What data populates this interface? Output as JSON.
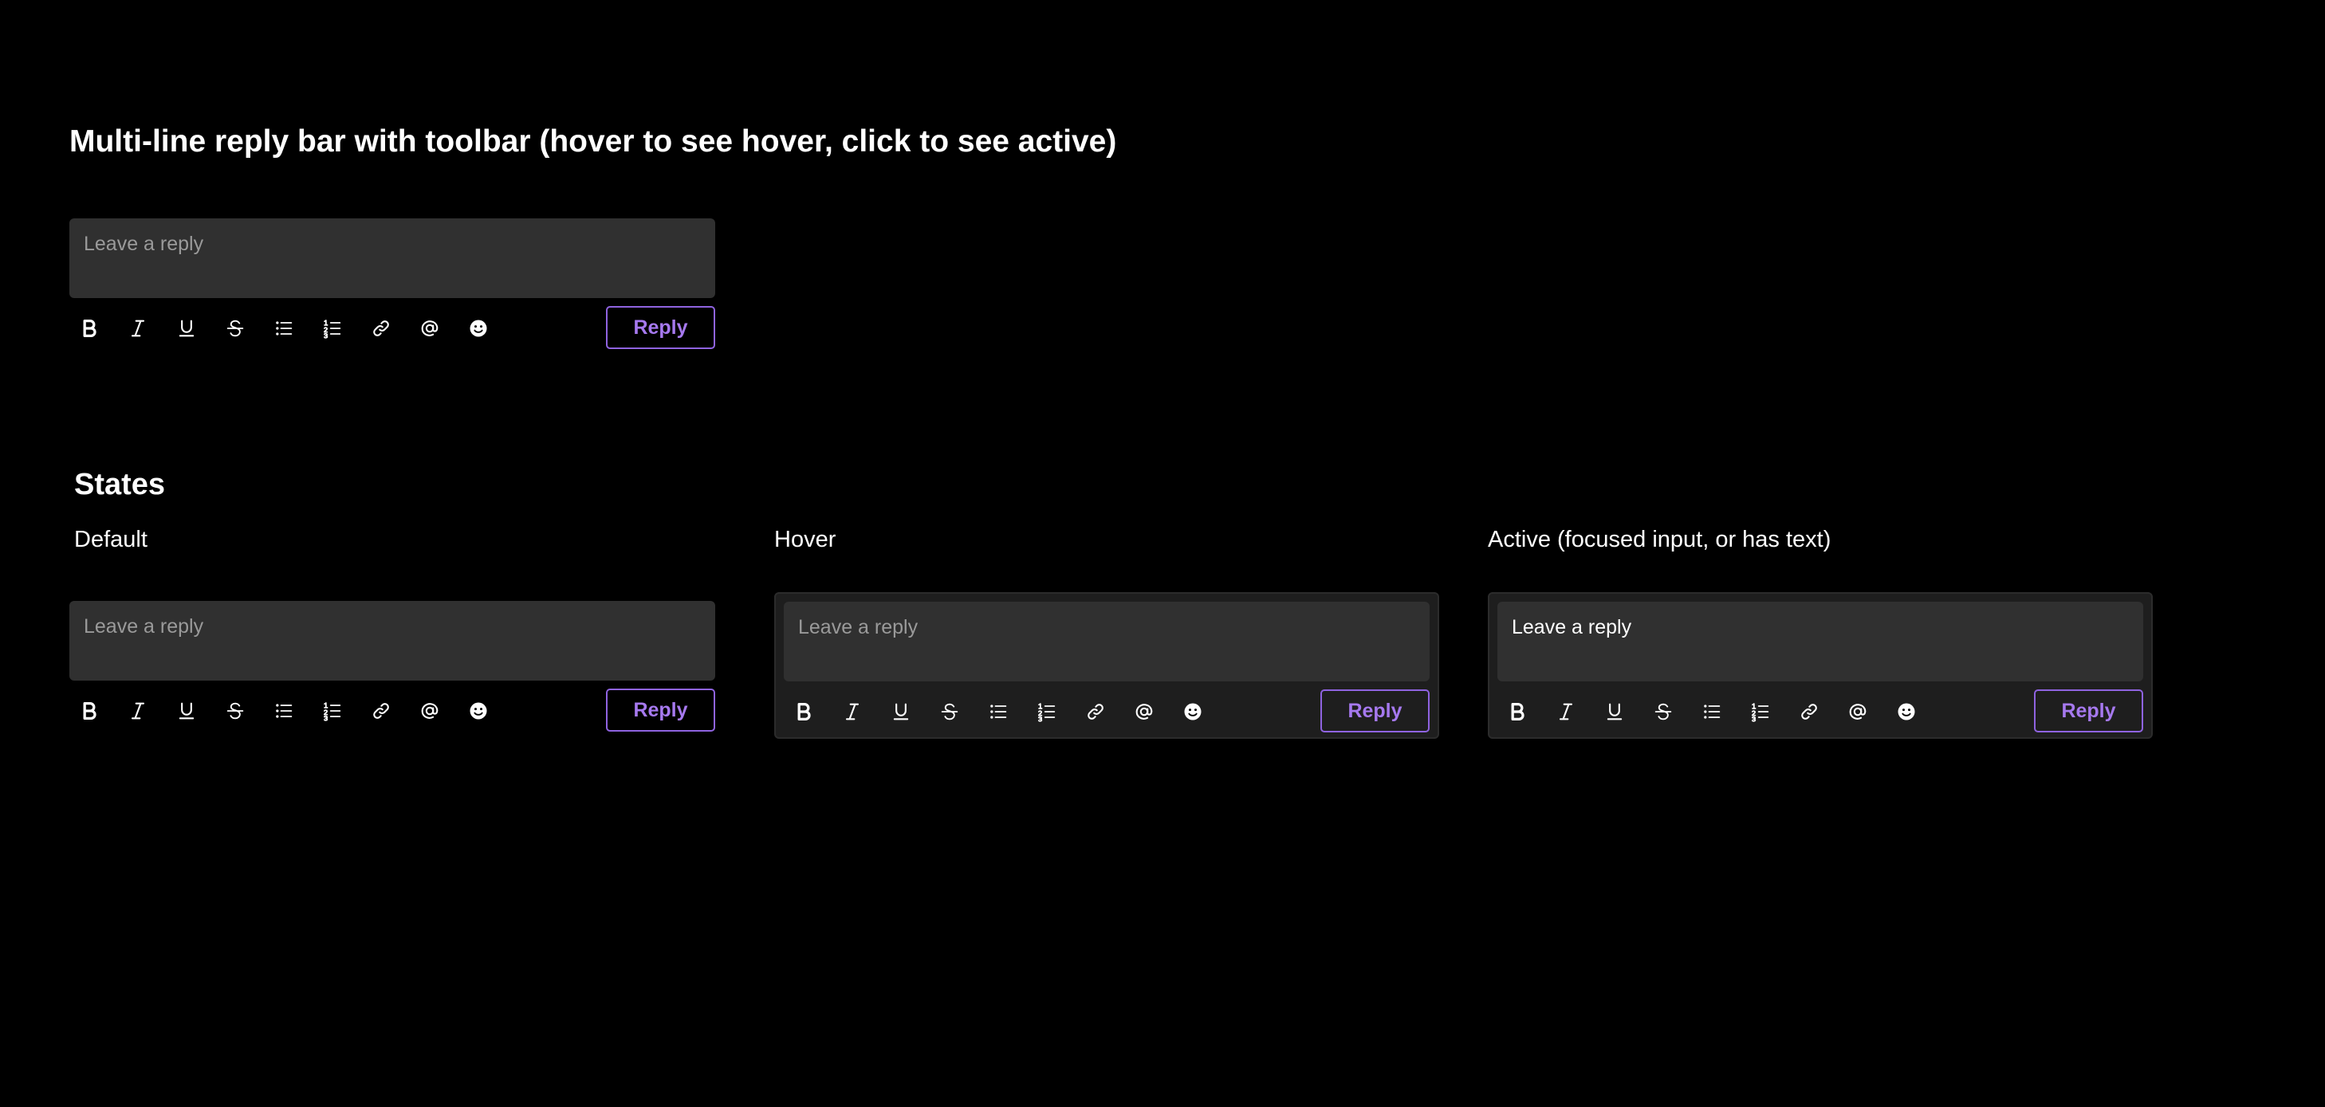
{
  "title": "Multi-line reply bar with toolbar (hover to see hover, click to see active)",
  "states_heading": "States",
  "states": {
    "default_label": "Default",
    "hover_label": "Hover",
    "active_label": "Active (focused input, or has text)"
  },
  "reply_bar": {
    "placeholder": "Leave a reply",
    "reply_label": "Reply"
  },
  "toolbar_icons": [
    "bold-icon",
    "italic-icon",
    "underline-icon",
    "strikethrough-icon",
    "bullet-list-icon",
    "numbered-list-icon",
    "link-icon",
    "mention-icon",
    "emoji-icon"
  ],
  "colors": {
    "background": "#000000",
    "input_background": "#303030",
    "panel_background": "#1e1e1e",
    "accent": "#a679ef",
    "accent_border": "#8f63e0",
    "placeholder": "#9a9a9a",
    "text": "#ffffff"
  }
}
